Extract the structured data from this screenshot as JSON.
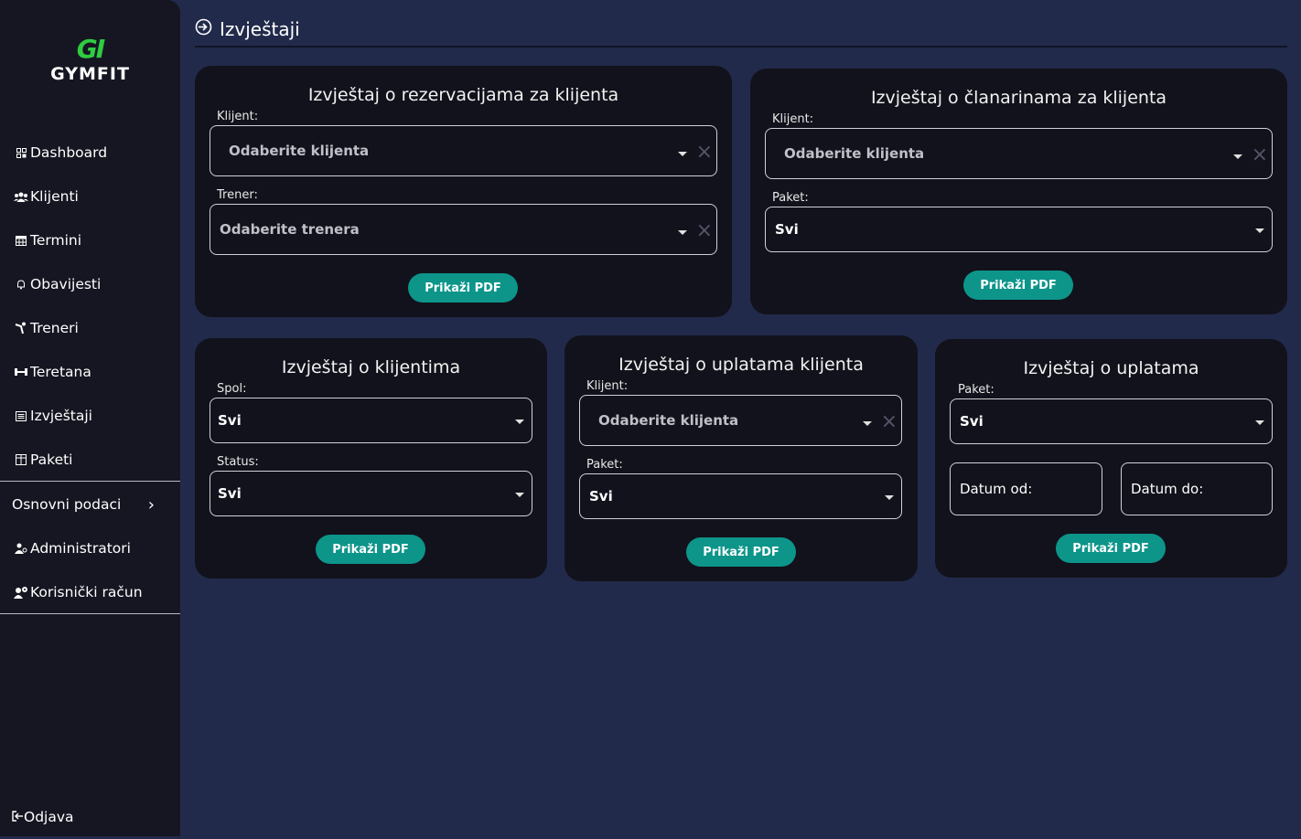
{
  "brand": {
    "mark": "GI",
    "name": "GYMFIT"
  },
  "nav": {
    "items": [
      {
        "label": "Dashboard",
        "icon": "dashboard-icon"
      },
      {
        "label": "Klijenti",
        "icon": "users-icon"
      },
      {
        "label": "Termini",
        "icon": "calendar-icon"
      },
      {
        "label": "Obavijesti",
        "icon": "bell-icon"
      },
      {
        "label": "Treneri",
        "icon": "trainer-icon"
      },
      {
        "label": "Teretana",
        "icon": "dumbbell-icon"
      },
      {
        "label": "Izvještaji",
        "icon": "report-icon"
      },
      {
        "label": "Paketi",
        "icon": "package-icon"
      }
    ],
    "basic_data": "Osnovni podaci",
    "admin": "Administratori",
    "account": "Korisnički račun",
    "logout": "Odjava"
  },
  "header": {
    "title": "Izvještaji"
  },
  "cards": {
    "reservations": {
      "title": "Izvještaj o rezervacijama za klijenta",
      "client_label": "Klijent:",
      "client_placeholder": "Odaberite klijenta",
      "trainer_label": "Trener:",
      "trainer_placeholder": "Odaberite trenera",
      "button": "Prikaži PDF"
    },
    "memberships": {
      "title": "Izvještaj o članarinama za klijenta",
      "client_label": "Klijent:",
      "client_placeholder": "Odaberite klijenta",
      "package_label": "Paket:",
      "package_value": "Svi",
      "button": "Prikaži PDF"
    },
    "clients": {
      "title": "Izvještaj o klijentima",
      "gender_label": "Spol:",
      "gender_value": "Svi",
      "status_label": "Status:",
      "status_value": "Svi",
      "button": "Prikaži PDF"
    },
    "client_payments": {
      "title": "Izvještaj o uplatama klijenta",
      "client_label": "Klijent:",
      "client_placeholder": "Odaberite klijenta",
      "package_label": "Paket:",
      "package_value": "Svi",
      "button": "Prikaži PDF"
    },
    "payments": {
      "title": "Izvještaj o uplatama",
      "package_label": "Paket:",
      "package_value": "Svi",
      "date_from_label": "Datum od:",
      "date_to_label": "Datum do:",
      "button": "Prikaži PDF"
    }
  },
  "colors": {
    "background": "#222a4b",
    "sidebar": "#161622",
    "card": "#12121c",
    "accent_button": "#0d958a",
    "logo_green": "#2ecc40"
  }
}
